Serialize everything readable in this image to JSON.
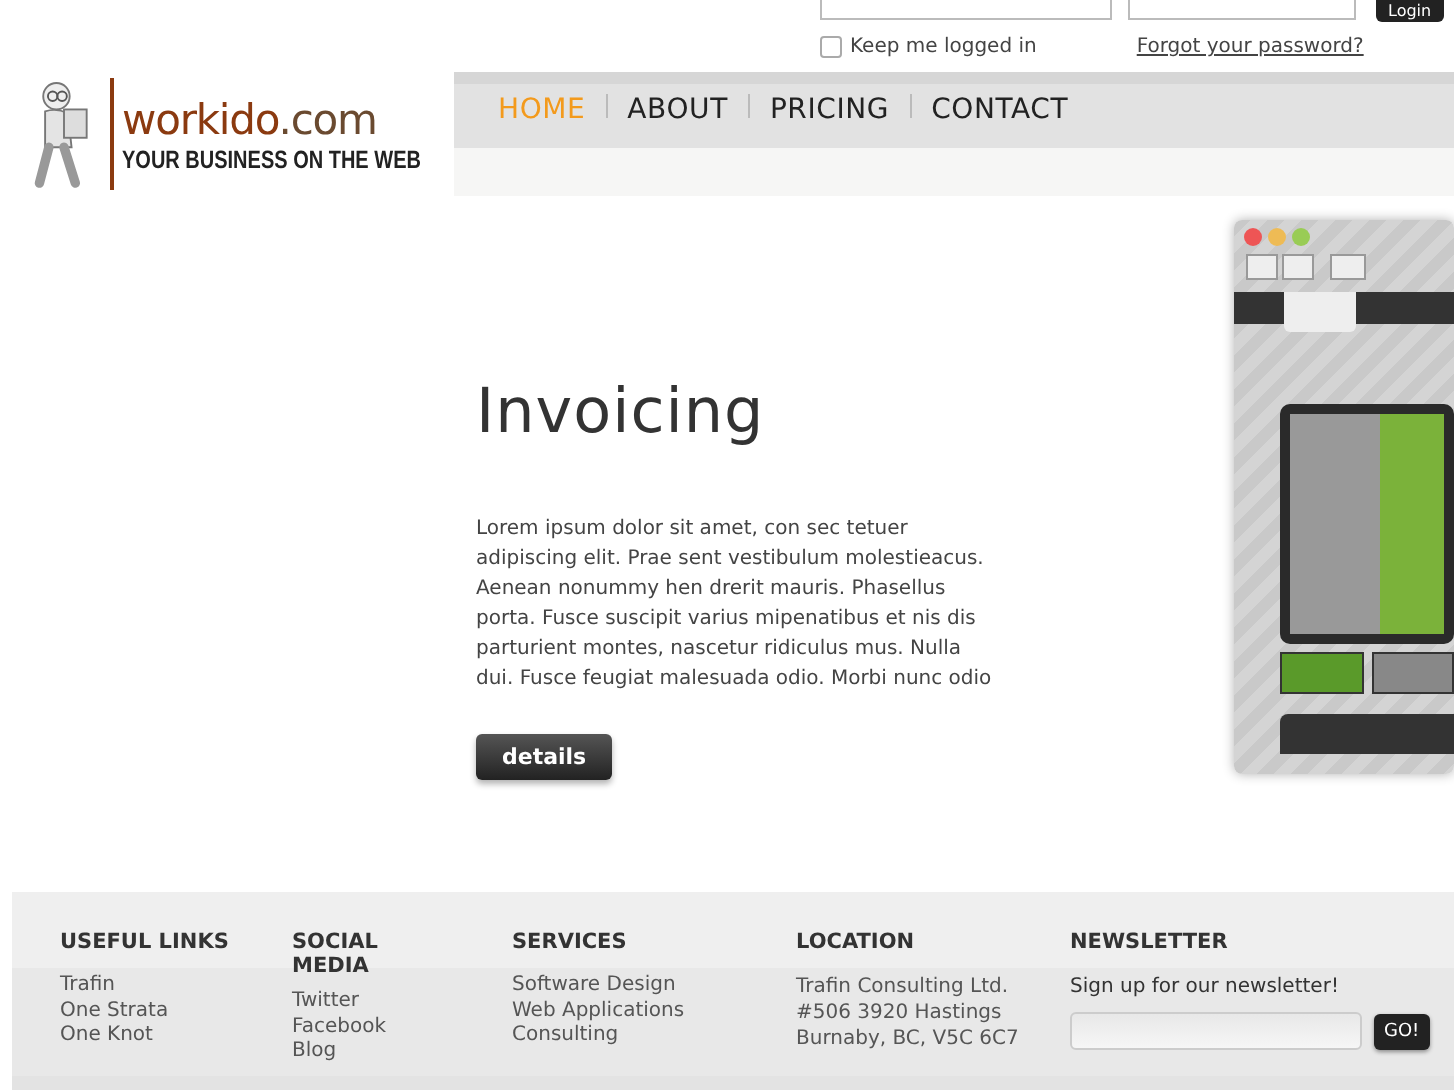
{
  "login": {
    "keep_logged_in": {
      "label": "Keep me logged in",
      "checked": false
    },
    "forgot_link": "Forgot your password?",
    "button": "Login"
  },
  "logo": {
    "name": "workido",
    "domain": ".com",
    "tagline": "YOUR BUSINESS ON THE WEB"
  },
  "nav": [
    {
      "label": "HOME",
      "selected": true
    },
    {
      "label": "ABOUT",
      "selected": false
    },
    {
      "label": "PRICING",
      "selected": false
    },
    {
      "label": "CONTACT",
      "selected": false
    }
  ],
  "hero": {
    "title": "Invoicing",
    "text": "Lorem ipsum dolor sit amet, con sec tetuer adipiscing elit. Prae sent vestibulum molestieacus. Aenean nonummy hen drerit mauris. Phasellus porta. Fusce suscipit varius mipenatibus et nis dis parturient montes, nascetur ridiculus mus. Nulla dui. Fusce feugiat malesuada odio. Morbi nunc odio",
    "button": "details"
  },
  "footer": {
    "columns": [
      {
        "heading": "USEFUL LINKS",
        "links": [
          "Trafin",
          "One Strata",
          "One Knot"
        ]
      },
      {
        "heading": "SOCIAL MEDIA",
        "links": [
          "Twitter",
          "Facebook",
          "Blog"
        ]
      },
      {
        "heading": "SERVICES",
        "links": [
          "Software Design",
          "Web Applications",
          "Consulting"
        ]
      },
      {
        "heading": "LOCATION",
        "lines": [
          "Trafin Consulting Ltd.",
          "#506 3920 Hastings",
          "Burnaby, BC, V5C 6C7"
        ]
      }
    ],
    "newsletter": {
      "heading": "NEWSLETTER",
      "text": "Sign up for our newsletter!",
      "button": "GO!"
    }
  }
}
